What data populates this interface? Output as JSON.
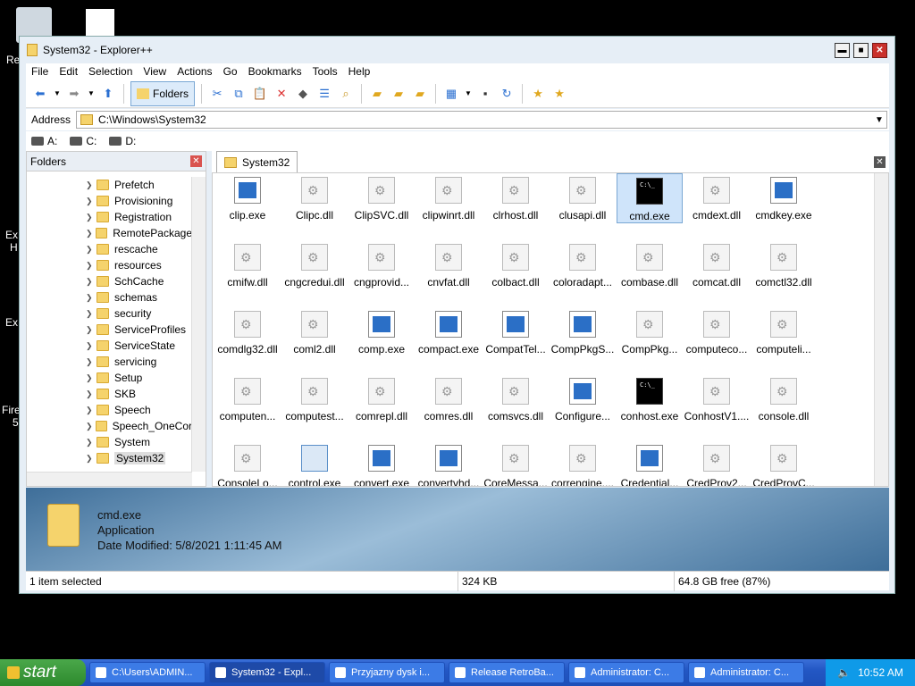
{
  "desktop": {
    "labels": [
      "Re",
      "Ex",
      "H",
      "Ex",
      "Fire",
      "5"
    ]
  },
  "window": {
    "title": "System32 - Explorer++",
    "controls": {
      "minimize": "▬",
      "maximize": "■",
      "close": "✕"
    }
  },
  "menu": [
    "File",
    "Edit",
    "Selection",
    "View",
    "Actions",
    "Go",
    "Bookmarks",
    "Tools",
    "Help"
  ],
  "toolbar": {
    "folders_label": "Folders"
  },
  "address": {
    "label": "Address",
    "value": "C:\\Windows\\System32"
  },
  "drives": [
    "A:",
    "C:",
    "D:"
  ],
  "folders_pane": {
    "title": "Folders",
    "items": [
      "Prefetch",
      "Provisioning",
      "Registration",
      "RemotePackage",
      "rescache",
      "resources",
      "SchCache",
      "schemas",
      "security",
      "ServiceProfiles",
      "ServiceState",
      "servicing",
      "Setup",
      "SKB",
      "Speech",
      "Speech_OneCor",
      "System",
      "System32"
    ],
    "selected": "System32"
  },
  "tab": {
    "label": "System32"
  },
  "files": [
    {
      "name": "clip.exe",
      "type": "exe"
    },
    {
      "name": "Clipc.dll",
      "type": "dll"
    },
    {
      "name": "ClipSVC.dll",
      "type": "dll"
    },
    {
      "name": "clipwinrt.dll",
      "type": "dll"
    },
    {
      "name": "clrhost.dll",
      "type": "dll"
    },
    {
      "name": "clusapi.dll",
      "type": "dll"
    },
    {
      "name": "cmd.exe",
      "type": "cmd",
      "selected": true
    },
    {
      "name": "cmdext.dll",
      "type": "dll"
    },
    {
      "name": "cmdkey.exe",
      "type": "exe"
    },
    {
      "name": "cmifw.dll",
      "type": "dll"
    },
    {
      "name": "cngcredui.dll",
      "type": "dll"
    },
    {
      "name": "cngprovid...",
      "type": "dll"
    },
    {
      "name": "cnvfat.dll",
      "type": "dll"
    },
    {
      "name": "colbact.dll",
      "type": "dll"
    },
    {
      "name": "coloradapt...",
      "type": "dll"
    },
    {
      "name": "combase.dll",
      "type": "dll"
    },
    {
      "name": "comcat.dll",
      "type": "dll"
    },
    {
      "name": "comctl32.dll",
      "type": "dll"
    },
    {
      "name": "comdlg32.dll",
      "type": "dll"
    },
    {
      "name": "coml2.dll",
      "type": "dll"
    },
    {
      "name": "comp.exe",
      "type": "exe"
    },
    {
      "name": "compact.exe",
      "type": "exe"
    },
    {
      "name": "CompatTel...",
      "type": "exe"
    },
    {
      "name": "CompPkgS...",
      "type": "exe"
    },
    {
      "name": "CompPkg...",
      "type": "dll"
    },
    {
      "name": "computeco...",
      "type": "dll"
    },
    {
      "name": "computeli...",
      "type": "dll"
    },
    {
      "name": "computen...",
      "type": "dll"
    },
    {
      "name": "computest...",
      "type": "dll"
    },
    {
      "name": "comrepl.dll",
      "type": "dll"
    },
    {
      "name": "comres.dll",
      "type": "dll"
    },
    {
      "name": "comsvcs.dll",
      "type": "dll"
    },
    {
      "name": "Configure...",
      "type": "exe"
    },
    {
      "name": "conhost.exe",
      "type": "cmd"
    },
    {
      "name": "ConhostV1....",
      "type": "dll"
    },
    {
      "name": "console.dll",
      "type": "dll"
    },
    {
      "name": "ConsoleLo...",
      "type": "dll"
    },
    {
      "name": "control.exe",
      "type": "ctl"
    },
    {
      "name": "convert.exe",
      "type": "exe"
    },
    {
      "name": "convertvhd...",
      "type": "exe"
    },
    {
      "name": "CoreMessa...",
      "type": "dll"
    },
    {
      "name": "correngine....",
      "type": "dll"
    },
    {
      "name": "Credential...",
      "type": "exe"
    },
    {
      "name": "CredProv2...",
      "type": "dll"
    },
    {
      "name": "CredProvC...",
      "type": "dll"
    }
  ],
  "info": {
    "name": "cmd.exe",
    "type": "Application",
    "modified": "Date Modified: 5/8/2021 1:11:45 AM"
  },
  "status": {
    "selected": "1 item selected",
    "size": "324 KB",
    "free": "64.8 GB free (87%)"
  },
  "taskbar": {
    "start": "start",
    "tasks": [
      {
        "label": "C:\\Users\\ADMIN...",
        "active": false
      },
      {
        "label": "System32 - Expl...",
        "active": true
      },
      {
        "label": "Przyjazny dysk i...",
        "active": false
      },
      {
        "label": "Release RetroBa...",
        "active": false
      },
      {
        "label": "Administrator: C...",
        "active": false
      },
      {
        "label": "Administrator: C...",
        "active": false
      }
    ],
    "clock": "10:52 AM"
  }
}
